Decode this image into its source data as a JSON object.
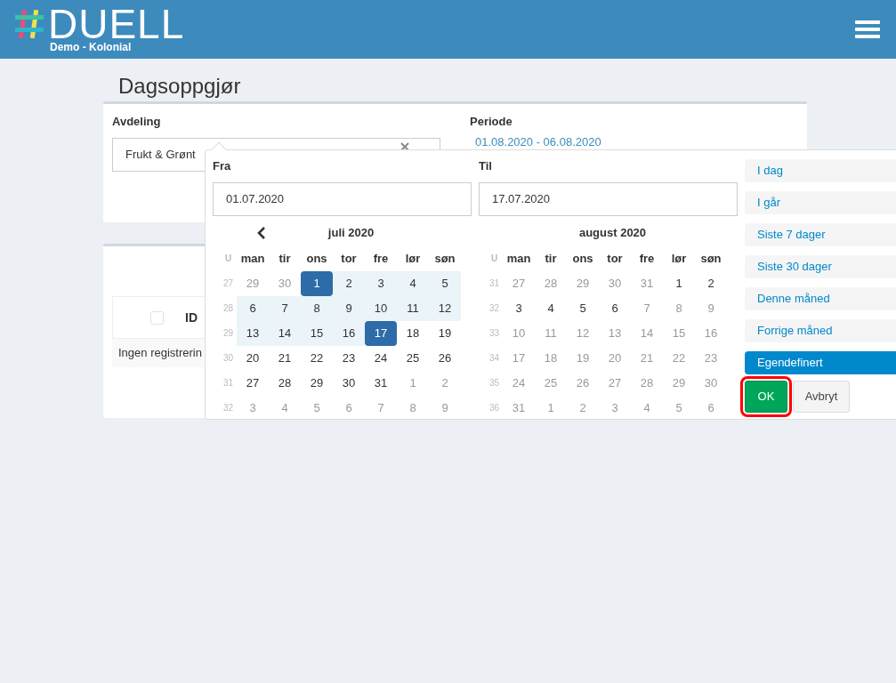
{
  "header": {
    "logo_text": "DUELL",
    "subtitle": "Demo - Kolonial"
  },
  "page_title": "Dagsoppgjør",
  "filters": {
    "department_label": "Avdeling",
    "department_value": "Frukt & Grønt",
    "period_label": "Periode",
    "period_value": "01.08.2020 - 06.08.2020"
  },
  "table": {
    "select_all_checked": false,
    "columns": [
      "ID"
    ],
    "empty_text": "Ingen registrerin"
  },
  "date_picker": {
    "from_label": "Fra",
    "from_value": "01.07.2020",
    "to_label": "Til",
    "to_value": "17.07.2020",
    "calendars": [
      {
        "title": "juli 2020",
        "has_prev": true,
        "week_header": "U",
        "weekdays": [
          "man",
          "tir",
          "ons",
          "tor",
          "fre",
          "lør",
          "søn"
        ],
        "weeks": [
          {
            "number": "27",
            "days": [
              {
                "text": "29",
                "muted": true,
                "in_range": false,
                "selected": false
              },
              {
                "text": "30",
                "muted": true,
                "in_range": false,
                "selected": false
              },
              {
                "text": "1",
                "muted": false,
                "in_range": true,
                "selected": true
              },
              {
                "text": "2",
                "muted": false,
                "in_range": true,
                "selected": false
              },
              {
                "text": "3",
                "muted": false,
                "in_range": true,
                "selected": false
              },
              {
                "text": "4",
                "muted": false,
                "in_range": true,
                "selected": false
              },
              {
                "text": "5",
                "muted": false,
                "in_range": true,
                "selected": false
              }
            ]
          },
          {
            "number": "28",
            "days": [
              {
                "text": "6",
                "muted": false,
                "in_range": true,
                "selected": false
              },
              {
                "text": "7",
                "muted": false,
                "in_range": true,
                "selected": false
              },
              {
                "text": "8",
                "muted": false,
                "in_range": true,
                "selected": false
              },
              {
                "text": "9",
                "muted": false,
                "in_range": true,
                "selected": false
              },
              {
                "text": "10",
                "muted": false,
                "in_range": true,
                "selected": false
              },
              {
                "text": "11",
                "muted": false,
                "in_range": true,
                "selected": false
              },
              {
                "text": "12",
                "muted": false,
                "in_range": true,
                "selected": false
              }
            ]
          },
          {
            "number": "29",
            "days": [
              {
                "text": "13",
                "muted": false,
                "in_range": true,
                "selected": false
              },
              {
                "text": "14",
                "muted": false,
                "in_range": true,
                "selected": false
              },
              {
                "text": "15",
                "muted": false,
                "in_range": true,
                "selected": false
              },
              {
                "text": "16",
                "muted": false,
                "in_range": true,
                "selected": false
              },
              {
                "text": "17",
                "muted": false,
                "in_range": true,
                "selected": true
              },
              {
                "text": "18",
                "muted": false,
                "in_range": false,
                "selected": false
              },
              {
                "text": "19",
                "muted": false,
                "in_range": false,
                "selected": false
              }
            ]
          },
          {
            "number": "30",
            "days": [
              {
                "text": "20",
                "muted": false,
                "in_range": false,
                "selected": false
              },
              {
                "text": "21",
                "muted": false,
                "in_range": false,
                "selected": false
              },
              {
                "text": "22",
                "muted": false,
                "in_range": false,
                "selected": false
              },
              {
                "text": "23",
                "muted": false,
                "in_range": false,
                "selected": false
              },
              {
                "text": "24",
                "muted": false,
                "in_range": false,
                "selected": false
              },
              {
                "text": "25",
                "muted": false,
                "in_range": false,
                "selected": false
              },
              {
                "text": "26",
                "muted": false,
                "in_range": false,
                "selected": false
              }
            ]
          },
          {
            "number": "31",
            "days": [
              {
                "text": "27",
                "muted": false,
                "in_range": false,
                "selected": false
              },
              {
                "text": "28",
                "muted": false,
                "in_range": false,
                "selected": false
              },
              {
                "text": "29",
                "muted": false,
                "in_range": false,
                "selected": false
              },
              {
                "text": "30",
                "muted": false,
                "in_range": false,
                "selected": false
              },
              {
                "text": "31",
                "muted": false,
                "in_range": false,
                "selected": false
              },
              {
                "text": "1",
                "muted": true,
                "in_range": false,
                "selected": false
              },
              {
                "text": "2",
                "muted": true,
                "in_range": false,
                "selected": false
              }
            ]
          },
          {
            "number": "32",
            "days": [
              {
                "text": "3",
                "muted": true,
                "in_range": false,
                "selected": false
              },
              {
                "text": "4",
                "muted": true,
                "in_range": false,
                "selected": false
              },
              {
                "text": "5",
                "muted": true,
                "in_range": false,
                "selected": false
              },
              {
                "text": "6",
                "muted": true,
                "in_range": false,
                "selected": false
              },
              {
                "text": "7",
                "muted": true,
                "in_range": false,
                "selected": false
              },
              {
                "text": "8",
                "muted": true,
                "in_range": false,
                "selected": false
              },
              {
                "text": "9",
                "muted": true,
                "in_range": false,
                "selected": false
              }
            ]
          }
        ]
      },
      {
        "title": "august 2020",
        "has_prev": false,
        "week_header": "U",
        "weekdays": [
          "man",
          "tir",
          "ons",
          "tor",
          "fre",
          "lør",
          "søn"
        ],
        "weeks": [
          {
            "number": "31",
            "days": [
              {
                "text": "27",
                "muted": true,
                "in_range": false,
                "selected": false
              },
              {
                "text": "28",
                "muted": true,
                "in_range": false,
                "selected": false
              },
              {
                "text": "29",
                "muted": true,
                "in_range": false,
                "selected": false
              },
              {
                "text": "30",
                "muted": true,
                "in_range": false,
                "selected": false
              },
              {
                "text": "31",
                "muted": true,
                "in_range": false,
                "selected": false
              },
              {
                "text": "1",
                "muted": false,
                "in_range": false,
                "selected": false
              },
              {
                "text": "2",
                "muted": false,
                "in_range": false,
                "selected": false
              }
            ]
          },
          {
            "number": "32",
            "days": [
              {
                "text": "3",
                "muted": false,
                "in_range": false,
                "selected": false
              },
              {
                "text": "4",
                "muted": false,
                "in_range": false,
                "selected": false
              },
              {
                "text": "5",
                "muted": false,
                "in_range": false,
                "selected": false
              },
              {
                "text": "6",
                "muted": false,
                "in_range": false,
                "selected": false
              },
              {
                "text": "7",
                "muted": true,
                "in_range": false,
                "selected": false
              },
              {
                "text": "8",
                "muted": true,
                "in_range": false,
                "selected": false
              },
              {
                "text": "9",
                "muted": true,
                "in_range": false,
                "selected": false
              }
            ]
          },
          {
            "number": "33",
            "days": [
              {
                "text": "10",
                "muted": true,
                "in_range": false,
                "selected": false
              },
              {
                "text": "11",
                "muted": true,
                "in_range": false,
                "selected": false
              },
              {
                "text": "12",
                "muted": true,
                "in_range": false,
                "selected": false
              },
              {
                "text": "13",
                "muted": true,
                "in_range": false,
                "selected": false
              },
              {
                "text": "14",
                "muted": true,
                "in_range": false,
                "selected": false
              },
              {
                "text": "15",
                "muted": true,
                "in_range": false,
                "selected": false
              },
              {
                "text": "16",
                "muted": true,
                "in_range": false,
                "selected": false
              }
            ]
          },
          {
            "number": "34",
            "days": [
              {
                "text": "17",
                "muted": true,
                "in_range": false,
                "selected": false
              },
              {
                "text": "18",
                "muted": true,
                "in_range": false,
                "selected": false
              },
              {
                "text": "19",
                "muted": true,
                "in_range": false,
                "selected": false
              },
              {
                "text": "20",
                "muted": true,
                "in_range": false,
                "selected": false
              },
              {
                "text": "21",
                "muted": true,
                "in_range": false,
                "selected": false
              },
              {
                "text": "22",
                "muted": true,
                "in_range": false,
                "selected": false
              },
              {
                "text": "23",
                "muted": true,
                "in_range": false,
                "selected": false
              }
            ]
          },
          {
            "number": "35",
            "days": [
              {
                "text": "24",
                "muted": true,
                "in_range": false,
                "selected": false
              },
              {
                "text": "25",
                "muted": true,
                "in_range": false,
                "selected": false
              },
              {
                "text": "26",
                "muted": true,
                "in_range": false,
                "selected": false
              },
              {
                "text": "27",
                "muted": true,
                "in_range": false,
                "selected": false
              },
              {
                "text": "28",
                "muted": true,
                "in_range": false,
                "selected": false
              },
              {
                "text": "29",
                "muted": true,
                "in_range": false,
                "selected": false
              },
              {
                "text": "30",
                "muted": true,
                "in_range": false,
                "selected": false
              }
            ]
          },
          {
            "number": "36",
            "days": [
              {
                "text": "31",
                "muted": true,
                "in_range": false,
                "selected": false
              },
              {
                "text": "1",
                "muted": true,
                "in_range": false,
                "selected": false
              },
              {
                "text": "2",
                "muted": true,
                "in_range": false,
                "selected": false
              },
              {
                "text": "3",
                "muted": true,
                "in_range": false,
                "selected": false
              },
              {
                "text": "4",
                "muted": true,
                "in_range": false,
                "selected": false
              },
              {
                "text": "5",
                "muted": true,
                "in_range": false,
                "selected": false
              },
              {
                "text": "6",
                "muted": true,
                "in_range": false,
                "selected": false
              }
            ]
          }
        ]
      }
    ],
    "ranges": [
      {
        "label": "I dag",
        "selected": false
      },
      {
        "label": "I går",
        "selected": false
      },
      {
        "label": "Siste 7 dager",
        "selected": false
      },
      {
        "label": "Siste 30 dager",
        "selected": false
      },
      {
        "label": "Denne måned",
        "selected": false
      },
      {
        "label": "Forrige måned",
        "selected": false
      },
      {
        "label": "Egendefinert",
        "selected": true
      }
    ],
    "buttons": [
      {
        "label": "OK",
        "kind": "apply",
        "highlighted": true
      },
      {
        "label": "Avbryt",
        "kind": "cancel",
        "highlighted": false
      }
    ]
  }
}
